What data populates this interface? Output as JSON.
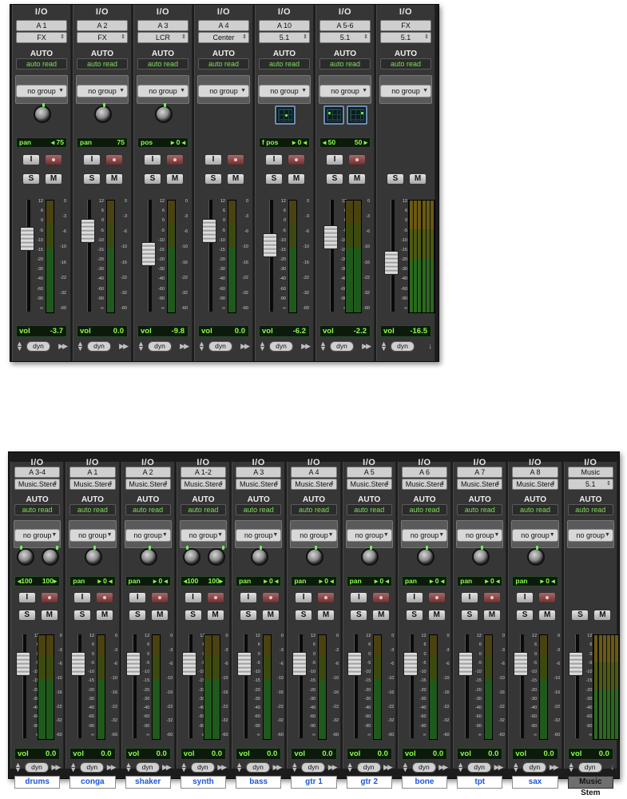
{
  "labels": {
    "io": "I/O",
    "auto": "AUTO",
    "group": "no group",
    "dyn": "dyn",
    "vol": "vol",
    "solo": "S",
    "mute": "M",
    "input": "I"
  },
  "scale_ticks": [
    "12",
    "6",
    "0",
    "-5",
    "-10",
    "-15",
    "-20",
    "-30",
    "-40",
    "-60",
    "-90",
    "∞"
  ],
  "meter_ticks": [
    "0",
    "-3",
    "-6",
    "-10",
    "-16",
    "-22",
    "-32",
    "-60"
  ],
  "top_mixer": {
    "strips": [
      {
        "input": "A 1",
        "output": "FX",
        "auto": "auto read",
        "control": "knob",
        "lcd": {
          "label": "pan",
          "value": "◂ 75"
        },
        "vol": "-3.7",
        "fader_pct": 0.31,
        "meter": "fill",
        "tail": "ff"
      },
      {
        "input": "A 2",
        "output": "FX",
        "auto": "auto read",
        "control": "knob",
        "lcd": {
          "label": "pan",
          "value": "75"
        },
        "vol": "0.0",
        "fader_pct": 0.22,
        "meter": "fill",
        "tail": "ff"
      },
      {
        "input": "A 3",
        "output": "LCR",
        "auto": "auto read",
        "control": "knob",
        "lcd": {
          "label": "pos",
          "value": "▸ 0 ◂"
        },
        "vol": "-9.8",
        "fader_pct": 0.48,
        "meter": "fill",
        "tail": "ff"
      },
      {
        "input": "A 4",
        "output": "Center",
        "auto": "auto read",
        "control": "none",
        "lcd": null,
        "vol": "0.0",
        "fader_pct": 0.22,
        "meter": "fill",
        "tail": "ff"
      },
      {
        "input": "A 10",
        "output": "5.1",
        "auto": "auto read",
        "control": "panner1",
        "lcd": {
          "label": "f pos",
          "value": "▸ 0 ◂"
        },
        "vol": "-6.2",
        "fader_pct": 0.38,
        "meter": "fill",
        "tail": "ff"
      },
      {
        "input": "A 5-6",
        "output": "5.1",
        "auto": "auto read",
        "control": "panner2",
        "lcd": {
          "label": "◂ 50",
          "value": "50 ▸"
        },
        "vol": "-2.2",
        "fader_pct": 0.29,
        "meter": "double",
        "tail": "ff"
      },
      {
        "input": "FX",
        "output": "5.1",
        "auto": "auto read",
        "control": "master",
        "lcd": null,
        "vol": "-16.5",
        "fader_pct": 0.58,
        "meter": "multi",
        "tail": "down"
      }
    ]
  },
  "bottom_mixer": {
    "strips": [
      {
        "input": "A 3-4",
        "output": "Music.Stere",
        "auto": "auto read",
        "control": "knob2",
        "lcd": {
          "label": "◂100",
          "value": "100▸"
        },
        "vol": "0.0",
        "name": "drums",
        "meter": "double"
      },
      {
        "input": "A 1",
        "output": "Music.Stere",
        "auto": "auto read",
        "control": "knob",
        "lcd": {
          "label": "pan",
          "value": "▸ 0 ◂"
        },
        "vol": "0.0",
        "name": "conga",
        "meter": "fill"
      },
      {
        "input": "A 2",
        "output": "Music.Stere",
        "auto": "auto read",
        "control": "knob",
        "lcd": {
          "label": "pan",
          "value": "▸ 0 ◂"
        },
        "vol": "0.0",
        "name": "shaker",
        "meter": "fill"
      },
      {
        "input": "A 1-2",
        "output": "Music.Stere",
        "auto": "auto read",
        "control": "knob2",
        "lcd": {
          "label": "◂100",
          "value": "100▸"
        },
        "vol": "0.0",
        "name": "synth",
        "meter": "double"
      },
      {
        "input": "A 3",
        "output": "Music.Stere",
        "auto": "auto read",
        "control": "knob",
        "lcd": {
          "label": "pan",
          "value": "▸ 0 ◂"
        },
        "vol": "0.0",
        "name": "bass",
        "meter": "fill"
      },
      {
        "input": "A 4",
        "output": "Music.Stere",
        "auto": "auto read",
        "control": "knob",
        "lcd": {
          "label": "pan",
          "value": "▸ 0 ◂"
        },
        "vol": "0.0",
        "name": "gtr 1",
        "meter": "fill"
      },
      {
        "input": "A 5",
        "output": "Music.Stere",
        "auto": "auto read",
        "control": "knob",
        "lcd": {
          "label": "pan",
          "value": "▸ 0 ◂"
        },
        "vol": "0.0",
        "name": "gtr 2",
        "meter": "fill"
      },
      {
        "input": "A 6",
        "output": "Music.Stere",
        "auto": "auto read",
        "control": "knob",
        "lcd": {
          "label": "pan",
          "value": "▸ 0 ◂"
        },
        "vol": "0.0",
        "name": "bone",
        "meter": "fill"
      },
      {
        "input": "A 7",
        "output": "Music.Stere",
        "auto": "auto read",
        "control": "knob",
        "lcd": {
          "label": "pan",
          "value": "▸ 0 ◂"
        },
        "vol": "0.0",
        "name": "tpt",
        "meter": "fill"
      },
      {
        "input": "A 8",
        "output": "Music.Stere",
        "auto": "auto read",
        "control": "knob",
        "lcd": {
          "label": "pan",
          "value": "▸ 0 ◂"
        },
        "vol": "0.0",
        "name": "sax",
        "meter": "fill"
      },
      {
        "input": "Music",
        "output": "5.1",
        "auto": "auto read",
        "control": "master",
        "lcd": null,
        "vol": "0.0",
        "name": "Music Stem",
        "meter": "multi"
      }
    ]
  }
}
